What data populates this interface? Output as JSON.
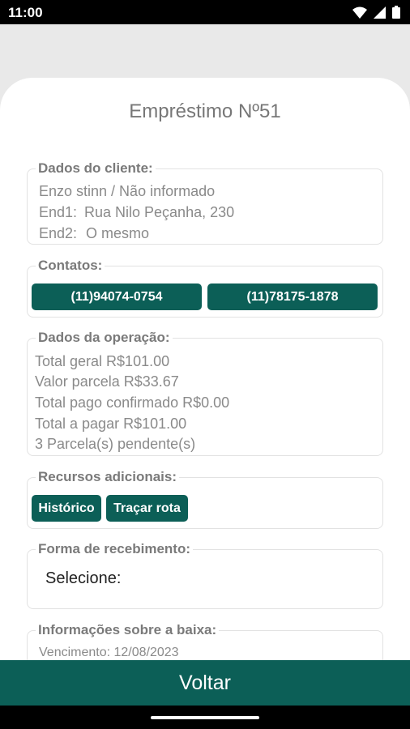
{
  "status_bar": {
    "time": "11:00"
  },
  "title": "Empréstimo Nº51",
  "cliente": {
    "legend": "Dados do cliente:",
    "name_line": "Enzo stinn / Não informado",
    "end1_label": "End1:",
    "end1_value": "Rua Nilo Peçanha, 230",
    "end2_label": "End2:",
    "end2_value": "O mesmo"
  },
  "contatos": {
    "legend": "Contatos:",
    "phone1": "(11)94074-0754",
    "phone2": "(11)78175-1878"
  },
  "operacao": {
    "legend": "Dados da operação:",
    "total_geral": "Total geral R$101.00",
    "valor_parcela": "Valor parcela R$33.67",
    "total_pago": "Total pago confirmado R$0.00",
    "total_a_pagar": "Total a pagar R$101.00",
    "parcelas_pendentes": "3 Parcela(s) pendente(s)"
  },
  "recursos": {
    "legend": "Recursos adicionais:",
    "historico": "Histórico",
    "tracar_rota": "Traçar rota"
  },
  "recebimento": {
    "legend": "Forma de recebimento:",
    "select_value": "Selecione:"
  },
  "baixa": {
    "legend": "Informações sobre a baixa:",
    "vencimento": "Vencimento: 12/08/2023"
  },
  "bottom_button": "Voltar",
  "colors": {
    "primary": "#0c5f57",
    "background": "#e9e9e9",
    "card": "#ffffff"
  }
}
